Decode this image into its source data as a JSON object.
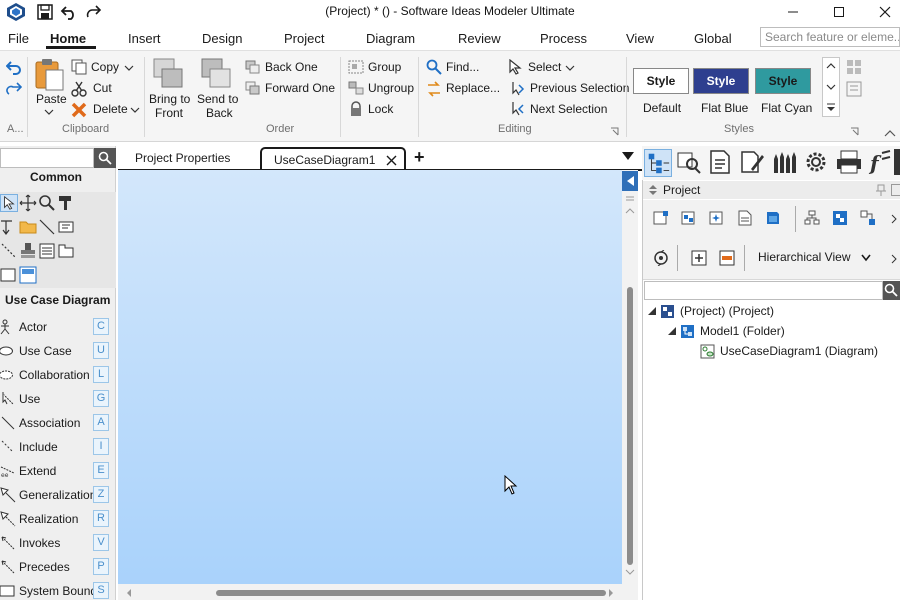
{
  "window": {
    "title": "(Project) *  ()  - Software Ideas Modeler Ultimate"
  },
  "menu": {
    "items": [
      "File",
      "Home",
      "Insert",
      "Design",
      "Project",
      "Diagram",
      "Review",
      "Process",
      "View",
      "Global"
    ],
    "active": "Home",
    "search_placeholder": "Search feature or eleme..."
  },
  "ribbon": {
    "clipboard": {
      "group_label": "Clipboard",
      "paste": "Paste",
      "copy": "Copy",
      "cut": "Cut",
      "delete": "Delete",
      "undo_group_label": "A..."
    },
    "order": {
      "group_label": "Order",
      "bring_to_front_1": "Bring to",
      "bring_to_front_2": "Front",
      "send_to_back_1": "Send to",
      "send_to_back_2": "Back",
      "back_one": "Back One",
      "forward_one": "Forward One",
      "group": "Group",
      "ungroup": "Ungroup",
      "lock": "Lock"
    },
    "editing": {
      "group_label": "Editing",
      "find": "Find...",
      "replace": "Replace...",
      "select": "Select",
      "previous_selection": "Previous Selection",
      "next_selection": "Next Selection"
    },
    "styles": {
      "group_label": "Styles",
      "items": [
        {
          "button": "Style",
          "caption": "Default",
          "bg": "#ffffff",
          "fg": "#1a1a1a"
        },
        {
          "button": "Style",
          "caption": "Flat Blue",
          "bg": "#2e3f8f",
          "fg": "#ffffff"
        },
        {
          "button": "Style",
          "caption": "Flat Cyan",
          "bg": "#2f9a9f",
          "fg": "#1a1a1a"
        }
      ]
    }
  },
  "toolbox": {
    "common_heading": "Common",
    "usecase_heading": "Use Case Diagram",
    "items": [
      {
        "label": "Actor",
        "key": "C"
      },
      {
        "label": "Use Case",
        "key": "U"
      },
      {
        "label": "Collaboration",
        "key": "L"
      },
      {
        "label": "Use",
        "key": "G"
      },
      {
        "label": "Association",
        "key": "A"
      },
      {
        "label": "Include",
        "key": "I"
      },
      {
        "label": "Extend",
        "key": "E"
      },
      {
        "label": "Generalization",
        "key": "Z"
      },
      {
        "label": "Realization",
        "key": "R"
      },
      {
        "label": "Invokes",
        "key": "V"
      },
      {
        "label": "Precedes",
        "key": "P"
      },
      {
        "label": "System Boundary",
        "key": "S"
      }
    ]
  },
  "tabs": {
    "project_properties": "Project Properties",
    "diagram": "UseCaseDiagram1",
    "add": "+"
  },
  "project_panel": {
    "title": "Project",
    "view_mode": "Hierarchical View",
    "tree": [
      {
        "label": "(Project) (Project)"
      },
      {
        "label": "Model1 (Folder)"
      },
      {
        "label": "UseCaseDiagram1 (Diagram)"
      }
    ]
  },
  "colors": {
    "canvas_top": "#d3e7fb",
    "canvas_bottom": "#a9d2fb",
    "accent_blue": "#1f6fc5",
    "shortcut_key": "#4a8fcb"
  }
}
